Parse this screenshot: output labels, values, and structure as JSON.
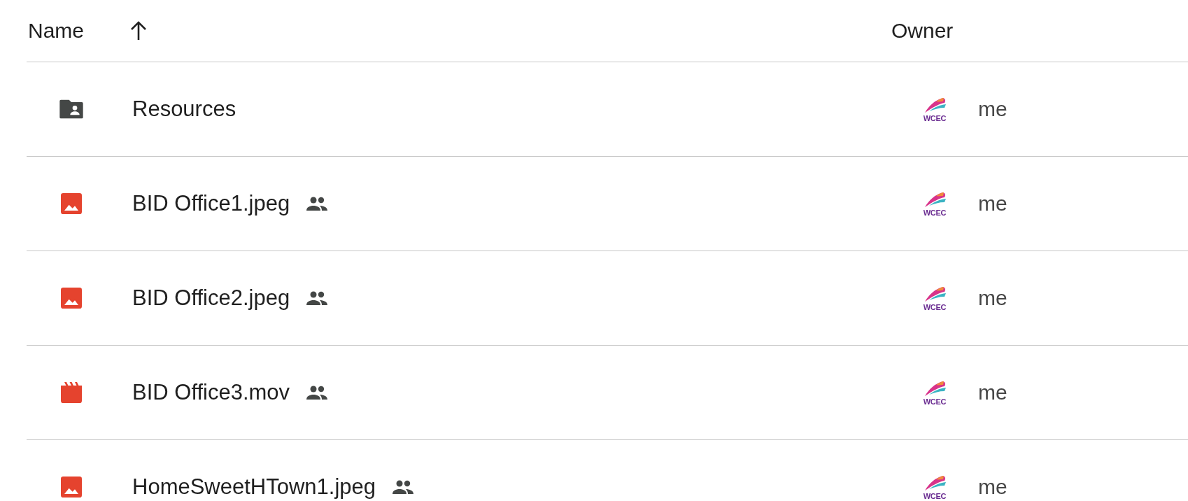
{
  "columns": [
    {
      "label": "Name",
      "sorted_ascending": true
    },
    {
      "label": "Owner"
    }
  ],
  "rows": [
    {
      "kind": "folder",
      "name": "Resources",
      "shared": false,
      "owner_logo": "WCEC",
      "owner": "me"
    },
    {
      "kind": "image",
      "name": "BID Office1.jpeg",
      "shared": true,
      "owner_logo": "WCEC",
      "owner": "me"
    },
    {
      "kind": "image",
      "name": "BID Office2.jpeg",
      "shared": true,
      "owner_logo": "WCEC",
      "owner": "me"
    },
    {
      "kind": "video",
      "name": "BID Office3.mov",
      "shared": true,
      "owner_logo": "WCEC",
      "owner": "me"
    },
    {
      "kind": "image",
      "name": "HomeSweetHTown1.jpeg",
      "shared": true,
      "owner_logo": "WCEC",
      "owner": "me"
    }
  ]
}
